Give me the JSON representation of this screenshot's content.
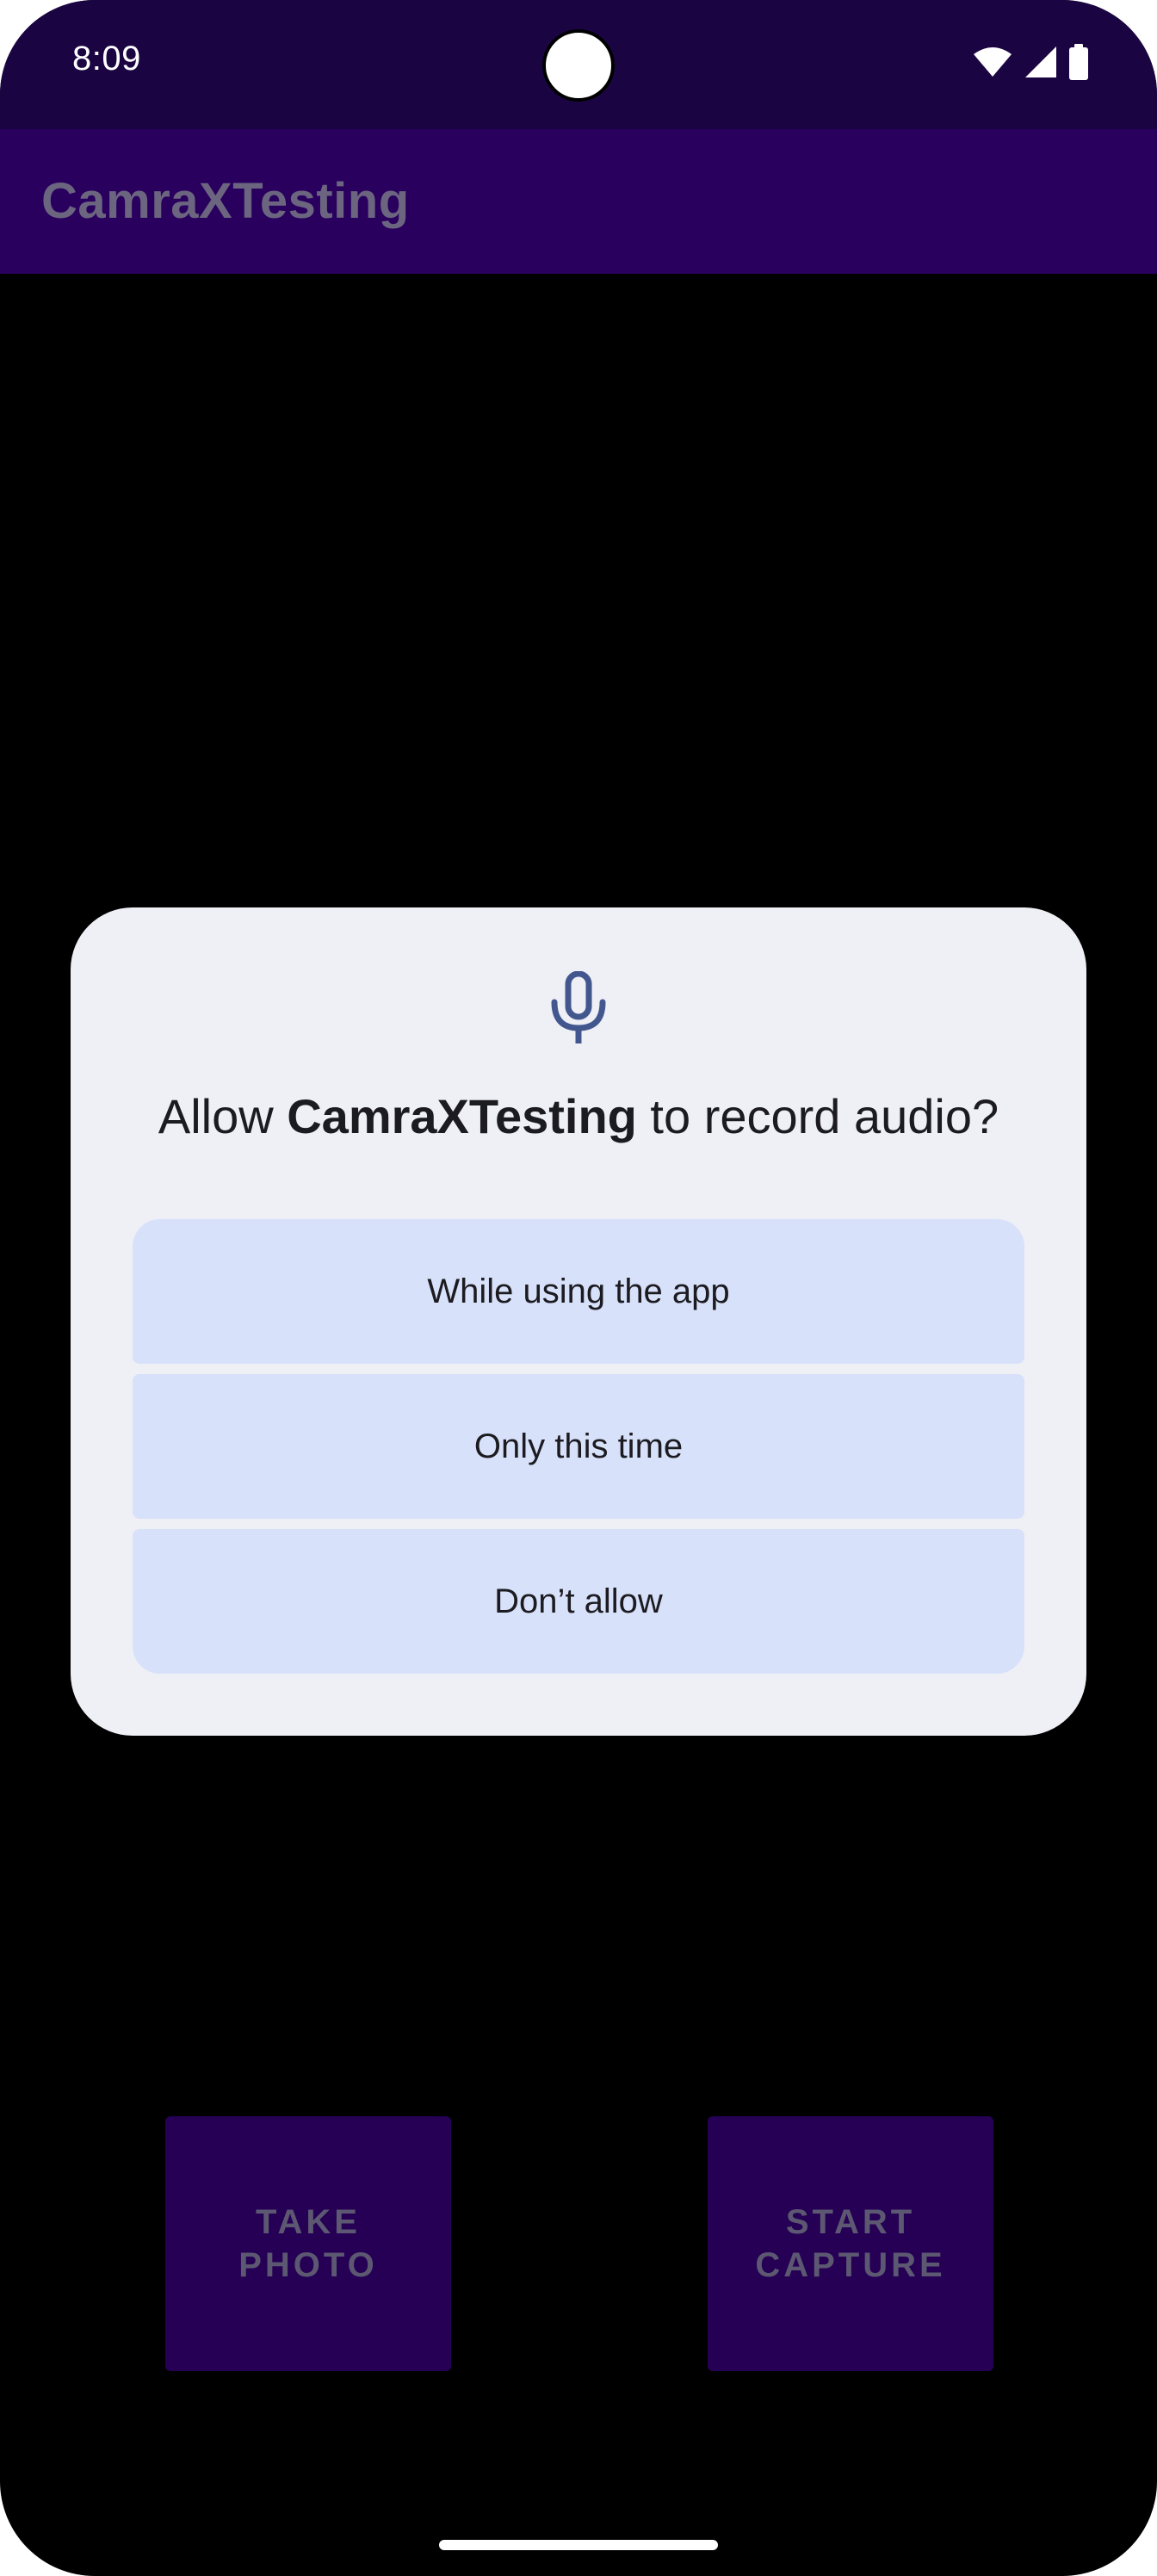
{
  "status_bar": {
    "time": "8:09",
    "icons": [
      "wifi-icon",
      "cell-signal-icon",
      "battery-icon"
    ]
  },
  "app_bar": {
    "title": "CamraXTesting"
  },
  "dialog": {
    "icon": "microphone-icon",
    "title_prefix": "Allow ",
    "title_app": "CamraXTesting",
    "title_suffix": " to record audio?",
    "buttons": {
      "while_using": "While using the app",
      "only_this_time": "Only this time",
      "dont_allow": "Don’t allow"
    }
  },
  "camera_controls": {
    "take_photo": "TAKE\nPHOTO",
    "start_capture": "START\nCAPTURE"
  },
  "colors": {
    "status_bar_bg": "#1a0542",
    "app_bar_bg": "#2a005f",
    "dialog_bg": "#efeff6",
    "dialog_button_bg": "#d8e1fa",
    "camera_button_bg": "#250055",
    "mic_icon": "#43578f"
  }
}
